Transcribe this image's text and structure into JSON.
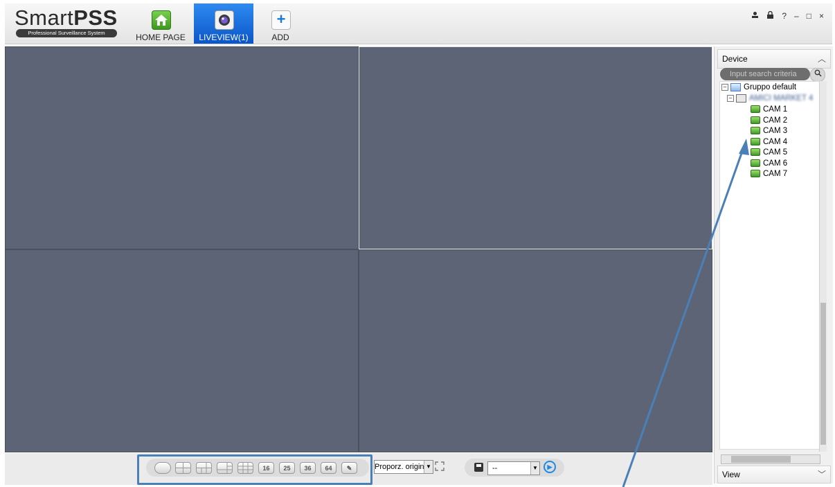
{
  "app": {
    "logo_main": "Smart",
    "logo_bold": "PSS",
    "logo_sub": "Professional Surveillance System"
  },
  "nav": {
    "home": "HOME PAGE",
    "liveview": "LIVEVIEW(1)",
    "add": "ADD",
    "add_symbol": "+"
  },
  "window_controls": {
    "user": "⚲",
    "lock": "🔒",
    "help": "?",
    "minimize": "–",
    "maximize": "□",
    "close": "×"
  },
  "device_panel": {
    "title": "Device",
    "search_placeholder": "Input search criteria",
    "group": "Gruppo default",
    "device_name": "AMICI MARKET 4",
    "cameras": [
      "CAM 1",
      "CAM 2",
      "CAM 3",
      "CAM 4",
      "CAM 5",
      "CAM 6",
      "CAM 7"
    ]
  },
  "view_panel": {
    "title": "View"
  },
  "toolbar": {
    "layouts": [
      "",
      "",
      "",
      "",
      "",
      "16",
      "25",
      "36",
      "64",
      "✎"
    ],
    "ratio": "Proporz. originale",
    "combo_value": "--"
  },
  "colors": {
    "video_bg": "#5c6475",
    "highlight": "#4a7fb8",
    "liveview_tab": "#1a6fe0"
  },
  "icons": {
    "home": "home-icon",
    "liveview": "camera-lens-icon",
    "add": "plus-icon",
    "folder": "folder-icon",
    "device": "dvr-icon",
    "camera": "camera-icon"
  }
}
